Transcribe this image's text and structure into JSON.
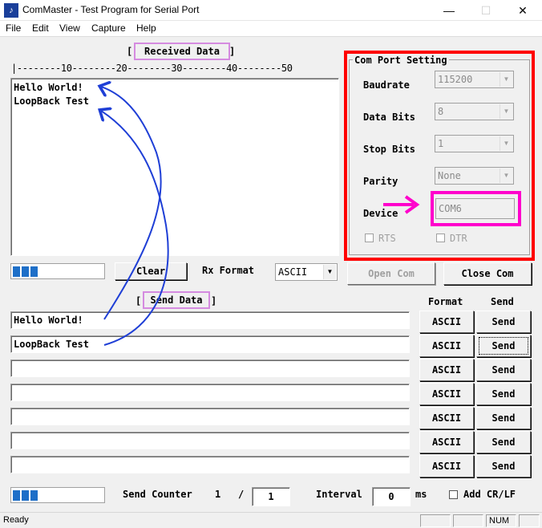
{
  "window": {
    "title": "ComMaster - Test Program for Serial Port",
    "icon_glyph": "♪"
  },
  "menu": [
    "File",
    "Edit",
    "View",
    "Capture",
    "Help"
  ],
  "received": {
    "title": "Received Data",
    "ruler": "|--------10--------20--------30--------40--------50",
    "lines": [
      "Hello World!",
      "LoopBack Test"
    ],
    "clear_label": "Clear",
    "rx_format_label": "Rx Format",
    "rx_format_value": "ASCII"
  },
  "com": {
    "group_title": "Com Port Setting",
    "baudrate_label": "Baudrate",
    "baudrate_value": "115200",
    "databits_label": "Data Bits",
    "databits_value": "8",
    "stopbits_label": "Stop Bits",
    "stopbits_value": "1",
    "parity_label": "Parity",
    "parity_value": "None",
    "device_label": "Device",
    "device_value": "COM6",
    "rts_label": "RTS",
    "dtr_label": "DTR",
    "open_label": "Open Com",
    "close_label": "Close Com"
  },
  "send": {
    "title": "Send Data",
    "format_header": "Format",
    "send_header": "Send",
    "rows": [
      {
        "text": "Hello World!",
        "format": "ASCII",
        "send": "Send"
      },
      {
        "text": "LoopBack Test",
        "format": "ASCII",
        "send": "Send"
      },
      {
        "text": "",
        "format": "ASCII",
        "send": "Send"
      },
      {
        "text": "",
        "format": "ASCII",
        "send": "Send"
      },
      {
        "text": "",
        "format": "ASCII",
        "send": "Send"
      },
      {
        "text": "",
        "format": "ASCII",
        "send": "Send"
      },
      {
        "text": "",
        "format": "ASCII",
        "send": "Send"
      }
    ],
    "counter_label": "Send Counter",
    "counter_value": "1",
    "counter_sep": "/",
    "counter_total": "1",
    "interval_label": "Interval",
    "interval_value": "0",
    "interval_unit": "ms",
    "crlf_label": "Add CR/LF"
  },
  "status": {
    "text": "Ready",
    "num": "NUM"
  },
  "colors": {
    "highlight_red": "#ff0000",
    "highlight_magenta": "#ff00cc",
    "title_box": "#d58be0",
    "arrow_blue": "#1f3fd6"
  }
}
